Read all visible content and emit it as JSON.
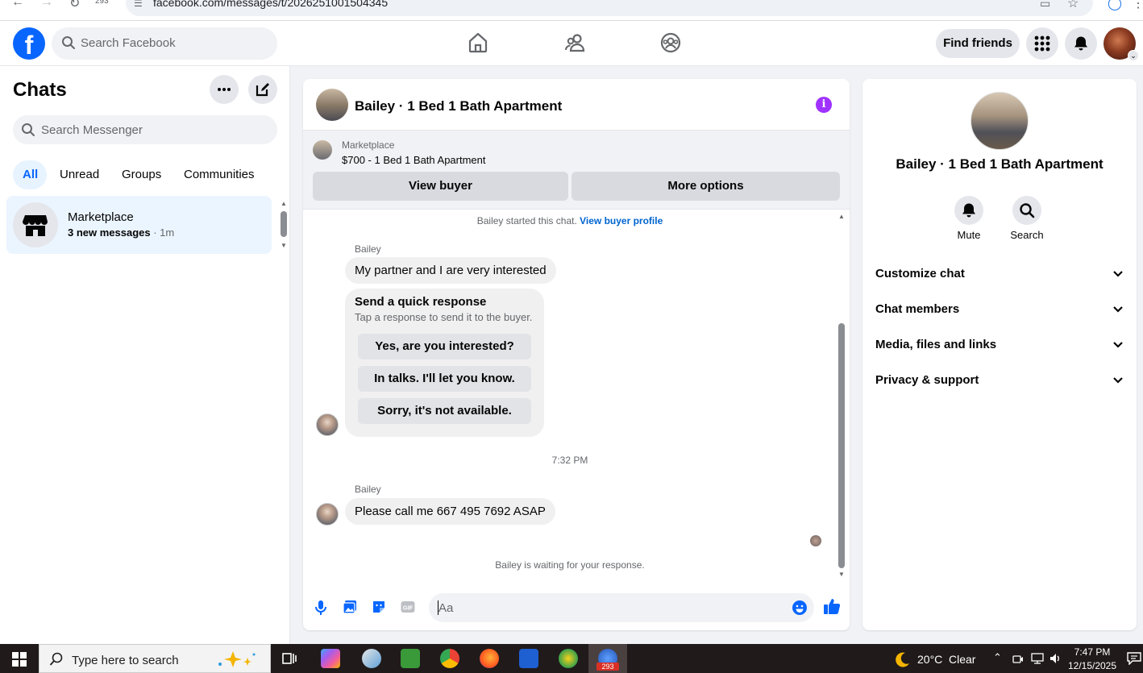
{
  "browser": {
    "tab_count": "293",
    "url": "facebook.com/messages/t/2026251001504345"
  },
  "topnav": {
    "logo": "f",
    "search_placeholder": "Search Facebook",
    "find_friends_label": "Find friends"
  },
  "left": {
    "title": "Chats",
    "search_placeholder": "Search Messenger",
    "filters": [
      "All",
      "Unread",
      "Groups",
      "Communities"
    ],
    "conversation": {
      "name": "Marketplace",
      "preview": "3 new messages",
      "time": " · 1m"
    }
  },
  "conversation": {
    "title": "Bailey · 1 Bed 1 Bath Apartment",
    "info_glyph": "i",
    "marketplace_label": "Marketplace",
    "listing": "$700 - 1 Bed 1 Bath Apartment",
    "view_buyer_label": "View buyer",
    "more_options_label": "More options",
    "started_text": "Bailey started this chat. ",
    "view_buyer_profile_label": "View buyer profile",
    "sender_name": "Bailey",
    "message_1": "My partner and I are very interested",
    "quick_response": {
      "title": "Send a quick response",
      "subtitle": "Tap a response to send it to the buyer.",
      "options": [
        "Yes, are you interested?",
        "In talks. I'll let you know.",
        "Sorry, it's not available."
      ]
    },
    "timestamp": "7:32 PM",
    "message_2": "Please call me 667 495 7692 ASAP",
    "waiting_text": "Bailey is waiting for your response.",
    "composer_placeholder": "Aa",
    "composer_icons": [
      "microphone-icon",
      "photo-icon",
      "sticker-icon",
      "gif-icon",
      "emoji-icon",
      "thumbs-up-icon"
    ],
    "gif_label": "GIF"
  },
  "right": {
    "title": "Bailey · 1 Bed 1 Bath Apartment",
    "mute_label": "Mute",
    "search_label": "Search",
    "sections": [
      "Customize chat",
      "Chat members",
      "Media, files and links",
      "Privacy & support"
    ]
  },
  "taskbar": {
    "search_placeholder": "Type here to search",
    "temperature": "20°C",
    "weather": "Clear",
    "time": "7:47 PM",
    "date": "12/15/2025",
    "badge": "293"
  },
  "colors": {
    "brand": "#0866ff",
    "info_accent": "#a033ff",
    "active_chat_bg": "#ebf5ff"
  }
}
